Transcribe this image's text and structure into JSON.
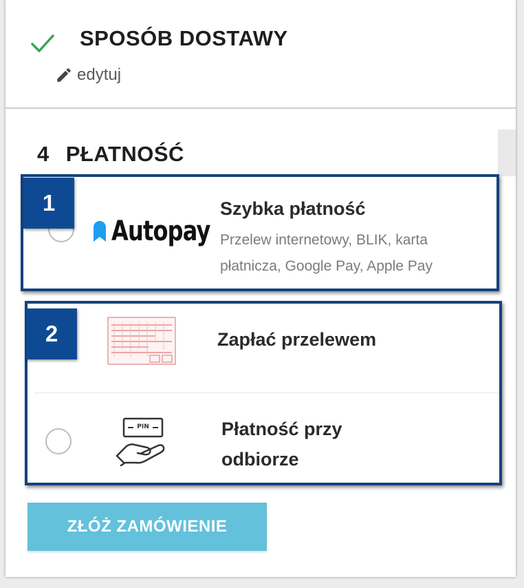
{
  "delivery": {
    "title": "SPOSÓB DOSTAWY",
    "edit_label": "edytuj",
    "status_icon": "check-icon",
    "status_color": "#3aa35a"
  },
  "payment": {
    "step_number": "4",
    "title": "PŁATNOŚĆ",
    "options": [
      {
        "logo_text": "Autopay",
        "title": "Szybka płatność",
        "description_line1": "Przelew internetowy, BLIK, karta",
        "description_line2": "płatnicza, Google Pay, Apple Pay",
        "selected": false
      },
      {
        "icon": "transfer-form-icon",
        "title": "Zapłać przelewem",
        "selected": false
      },
      {
        "icon": "hand-card-pin-icon",
        "icon_text": "PIN",
        "title_line1": "Płatność przy",
        "title_line2": "odbiorze",
        "selected": false
      }
    ]
  },
  "annotations": {
    "badge_1": "1",
    "badge_2": "2",
    "color": "#15427e"
  },
  "submit": {
    "label": "ZŁÓŻ ZAMÓWIENIE",
    "color": "#63c1db"
  }
}
